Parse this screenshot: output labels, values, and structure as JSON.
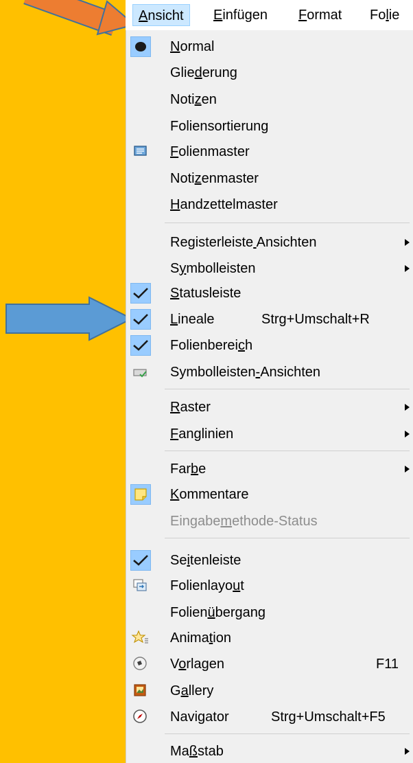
{
  "menubar": {
    "items": [
      {
        "before": "",
        "mnemonic": "A",
        "after": "nsicht"
      },
      {
        "before": "",
        "mnemonic": "E",
        "after": "infügen"
      },
      {
        "before": "",
        "mnemonic": "F",
        "after": "ormat"
      },
      {
        "before": "Fo",
        "mnemonic": "l",
        "after": "ie"
      }
    ]
  },
  "menu": {
    "items": [
      {
        "before": "",
        "mnemonic": "N",
        "after": "ormal"
      },
      {
        "before": "Glie",
        "mnemonic": "d",
        "after": "erung"
      },
      {
        "before": "Noti",
        "mnemonic": "z",
        "after": "en"
      },
      {
        "before": "Foliensortierun",
        "mnemonic": "g",
        "after": ""
      },
      {
        "before": "",
        "mnemonic": "F",
        "after": "olienmaster"
      },
      {
        "before": "Noti",
        "mnemonic": "z",
        "after": "enmaster"
      },
      {
        "before": "",
        "mnemonic": "H",
        "after": "andzettelmaster"
      },
      {
        "before": "Registerleiste",
        "mnemonic": " ",
        "after": "Ansichten"
      },
      {
        "before": "S",
        "mnemonic": "y",
        "after": "mbolleisten"
      },
      {
        "before": "",
        "mnemonic": "S",
        "after": "tatusleiste"
      },
      {
        "before": "",
        "mnemonic": "L",
        "after": "ineale",
        "accel": "Strg+Umschalt+R"
      },
      {
        "before": "Folienberei",
        "mnemonic": "c",
        "after": "h"
      },
      {
        "before": "Symbolleisten",
        "mnemonic": "-",
        "after": "Ansichten"
      },
      {
        "before": "",
        "mnemonic": "R",
        "after": "aster"
      },
      {
        "before": "",
        "mnemonic": "F",
        "after": "anglinien"
      },
      {
        "before": "Far",
        "mnemonic": "b",
        "after": "e"
      },
      {
        "before": "",
        "mnemonic": "K",
        "after": "ommentare"
      },
      {
        "before": "Eingabe",
        "mnemonic": "m",
        "after": "ethode-Status"
      },
      {
        "before": "Se",
        "mnemonic": "i",
        "after": "tenleiste"
      },
      {
        "before": "Folienlayo",
        "mnemonic": "u",
        "after": "t"
      },
      {
        "before": "Folien",
        "mnemonic": "ü",
        "after": "bergang"
      },
      {
        "before": "Anima",
        "mnemonic": "t",
        "after": "ion"
      },
      {
        "before": "V",
        "mnemonic": "o",
        "after": "rlagen",
        "accel": "F11"
      },
      {
        "before": "G",
        "mnemonic": "a",
        "after": "llery"
      },
      {
        "before": "Navi",
        "mnemonic": "g",
        "after": "ator",
        "accel": "Strg+Umschalt+F5"
      },
      {
        "before": "Ma",
        "mnemonic": "ß",
        "after": "stab"
      }
    ]
  },
  "colors": {
    "background": "#FFC000",
    "menu_background": "#F0F0F0",
    "highlight": "#CCE8FF",
    "checked": "#99CCFF",
    "arrow_orange": "#ED7D31",
    "arrow_blue": "#5B9BD5"
  },
  "icons": {
    "normal": "bullet-icon",
    "folienmaster": "slide-master-icon",
    "checks": "checkmark-icon",
    "symbolleisten_ansichten": "toolbar-view-icon",
    "kommentare": "sticky-note-icon",
    "folienlayout": "slide-layout-icon",
    "animation": "star-animation-icon",
    "vorlagen": "styles-icon",
    "gallery": "gallery-icon",
    "navigator": "compass-icon"
  }
}
